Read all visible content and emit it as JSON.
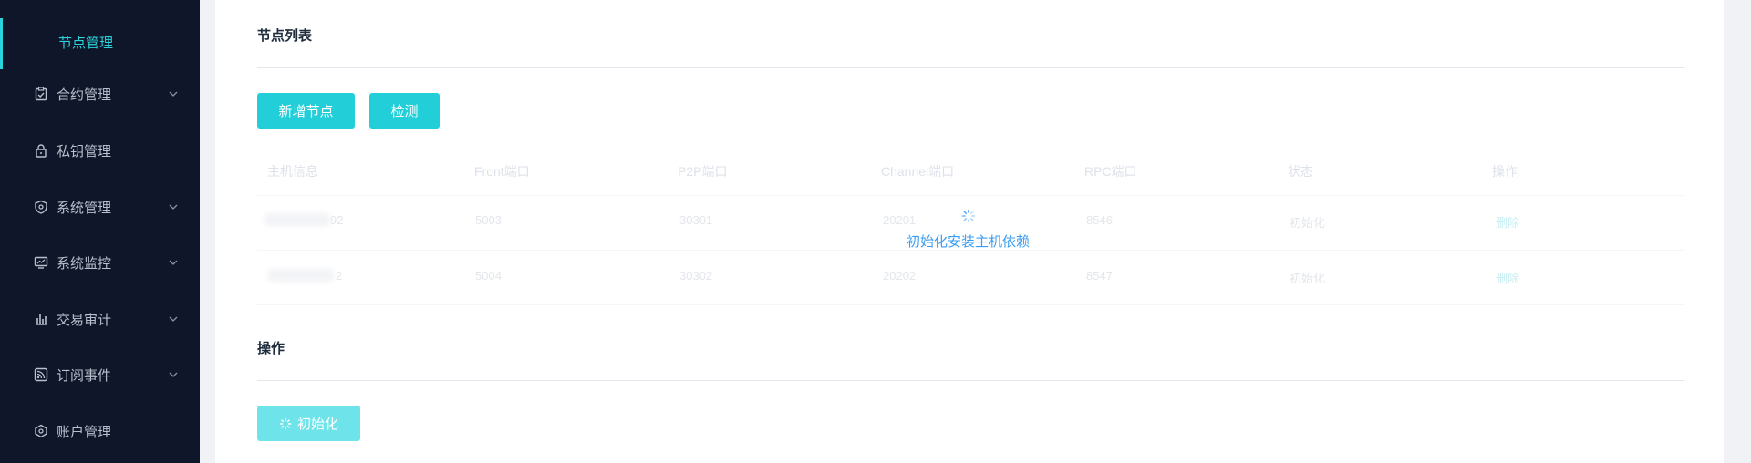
{
  "sidebar": {
    "items": [
      {
        "label": "节点管理",
        "icon": "node-icon",
        "active": true
      },
      {
        "label": "合约管理",
        "icon": "clipboard-check-icon",
        "expandable": true
      },
      {
        "label": "私钥管理",
        "icon": "lock-icon",
        "expandable": false
      },
      {
        "label": "系统管理",
        "icon": "shield-icon",
        "expandable": true
      },
      {
        "label": "系统监控",
        "icon": "monitor-chart-icon",
        "expandable": true
      },
      {
        "label": "交易审计",
        "icon": "bar-chart-icon",
        "expandable": true
      },
      {
        "label": "订阅事件",
        "icon": "rss-icon",
        "expandable": true
      },
      {
        "label": "账户管理",
        "icon": "hexagon-icon",
        "expandable": false
      }
    ],
    "colors": {
      "bg": "#0f1629",
      "active": "#2ad4dc",
      "text": "#b9c0cc"
    }
  },
  "node_list": {
    "title": "节点列表",
    "add_button": "新增节点",
    "check_button": "检测",
    "columns": [
      "主机信息",
      "Front端口",
      "P2P端口",
      "Channel端口",
      "RPC端口",
      "状态",
      "操作"
    ],
    "rows": [
      {
        "host_suffix": "92",
        "front": "5003",
        "p2p": "30301",
        "channel": "20201",
        "rpc": "8546",
        "status": "初始化",
        "action": "删除"
      },
      {
        "host_suffix": "2",
        "front": "5004",
        "p2p": "30302",
        "channel": "20202",
        "rpc": "8547",
        "status": "初始化",
        "action": "删除"
      }
    ],
    "loading_text": "初始化安装主机依赖"
  },
  "operations": {
    "title": "操作",
    "init_button": "初始化"
  },
  "accent": "#22cfd9"
}
